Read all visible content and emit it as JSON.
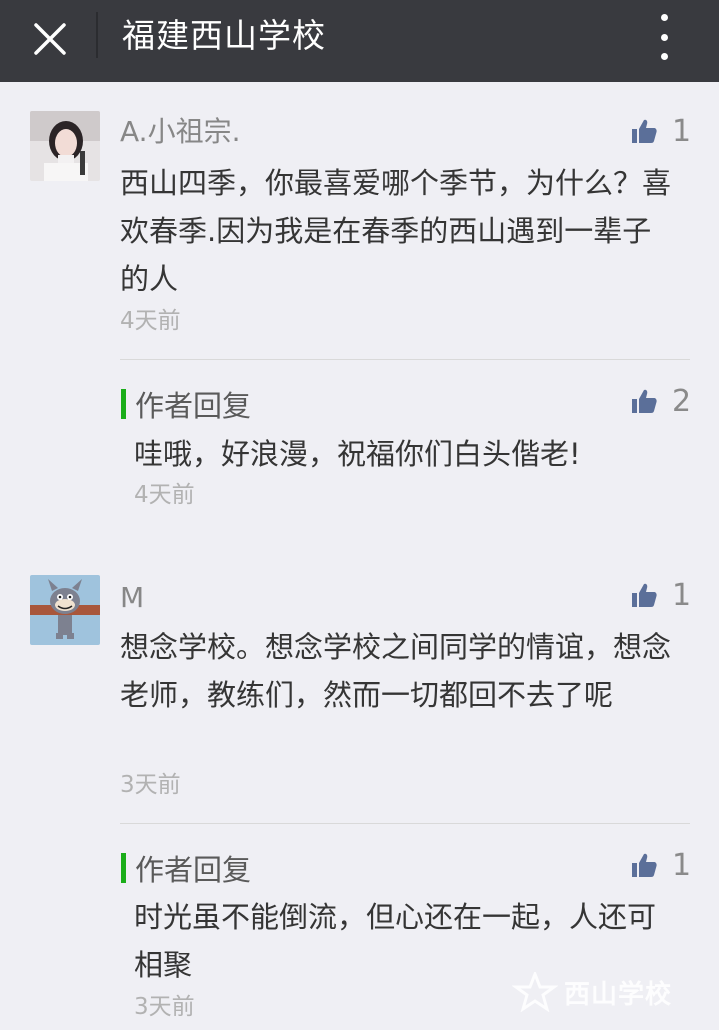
{
  "header": {
    "title": "福建西山学校",
    "close_icon": "close-icon",
    "more_icon": "more-vertical-icon"
  },
  "comments": [
    {
      "nickname": "A.小祖宗.",
      "avatar": "avatar-girl-photo",
      "likes": "1",
      "content": "西山四季，你最喜爱哪个季节，为什么？喜欢春季.因为我是在春季的西山遇到一辈子的人",
      "time": "4天前",
      "reply": {
        "label": "作者回复",
        "likes": "2",
        "content": "哇哦，好浪漫，祝福你们白头偕老!",
        "time": "4天前"
      }
    },
    {
      "nickname": "M",
      "avatar": "avatar-cartoon-cat",
      "likes": "1",
      "content": "想念学校。想念学校之间同学的情谊，想念老师，教练们，然而一切都回不去了呢",
      "time": "3天前",
      "reply": {
        "label": "作者回复",
        "likes": "1",
        "content": "时光虽不能倒流，但心还在一起，人还可相聚",
        "time": "3天前"
      }
    }
  ],
  "watermark": "西山学校",
  "colors": {
    "header_bg": "#393a3f",
    "page_bg": "#efeff4",
    "reply_bar": "#1aad19",
    "like_icon": "#5b6f99"
  }
}
